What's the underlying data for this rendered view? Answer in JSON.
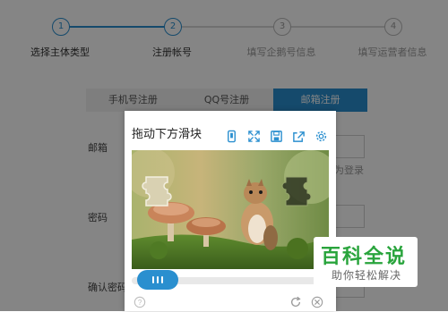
{
  "steps": [
    {
      "num": "1",
      "label": "选择主体类型"
    },
    {
      "num": "2",
      "label": "注册帐号"
    },
    {
      "num": "3",
      "label": "填写企鹅号信息"
    },
    {
      "num": "4",
      "label": "填写运营者信息"
    }
  ],
  "tabs": [
    {
      "label": "手机号注册"
    },
    {
      "label": "QQ号注册"
    },
    {
      "label": "邮箱注册"
    }
  ],
  "form": {
    "email_label": "邮箱",
    "password_label": "密码",
    "confirm_label": "确认密码",
    "login_hint": "为登录"
  },
  "captcha": {
    "title": "拖动下方滑块",
    "icons": [
      "mobile-icon",
      "fullscreen-icon",
      "save-icon",
      "share-icon",
      "settings-icon"
    ],
    "slider_progress": 0,
    "footer_icons": [
      "help-icon",
      "refresh-icon",
      "close-icon"
    ]
  },
  "watermark": {
    "main": "百科全说",
    "sub": "助你轻松解决"
  },
  "colors": {
    "accent": "#2a8fcf",
    "watermark_green": "#29a43c"
  }
}
